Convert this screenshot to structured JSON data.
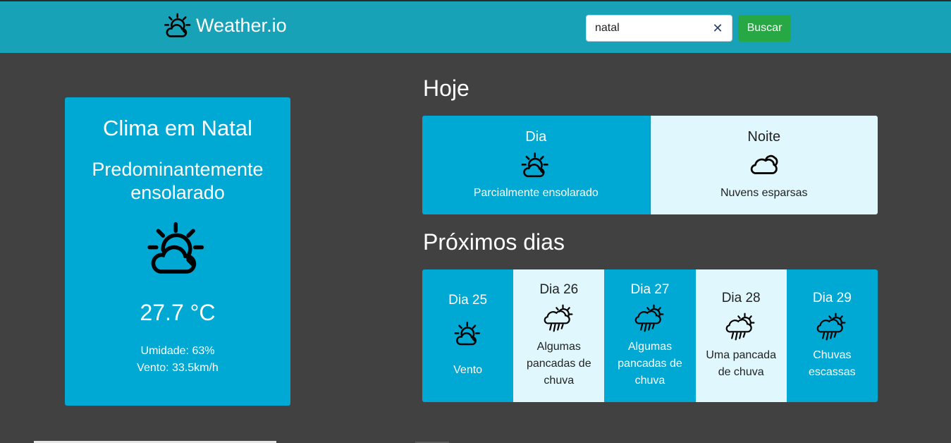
{
  "header": {
    "brand": "Weather.io",
    "brand_icon": "partly-cloudy-icon",
    "search_value": "natal",
    "clear_icon": "close-icon",
    "search_button": "Buscar",
    "colors": {
      "navbar": "#17a2b8",
      "button": "#28a745"
    }
  },
  "current": {
    "title": "Clima em Natal",
    "condition": "Predominantemente ensolarado",
    "icon": "partly-sunny-icon",
    "temperature": "27.7 °C",
    "humidity": "Umidade: 63%",
    "wind": "Vento: 33.5km/h"
  },
  "today": {
    "heading": "Hoje",
    "day": {
      "label": "Dia",
      "icon": "partly-sunny-icon",
      "description": "Parcialmente ensolarado"
    },
    "night": {
      "label": "Noite",
      "icon": "cloud-icon",
      "description": "Nuvens esparsas"
    }
  },
  "next": {
    "heading": "Próximos dias",
    "days": [
      {
        "label": "Dia 25",
        "icon": "partly-sunny-icon",
        "description": "Vento"
      },
      {
        "label": "Dia 26",
        "icon": "sun-rain-icon",
        "description": "Algumas pancadas de chuva"
      },
      {
        "label": "Dia 27",
        "icon": "sun-rain-icon",
        "description": "Algumas pancadas de chuva"
      },
      {
        "label": "Dia 28",
        "icon": "sun-rain-icon",
        "description": "Uma pancada de chuva"
      },
      {
        "label": "Dia 29",
        "icon": "sun-rain-icon",
        "description": "Chuvas escassas"
      }
    ]
  },
  "colors": {
    "background": "#414141",
    "card": "#00a8d4",
    "card_light": "#e0f8fd"
  }
}
